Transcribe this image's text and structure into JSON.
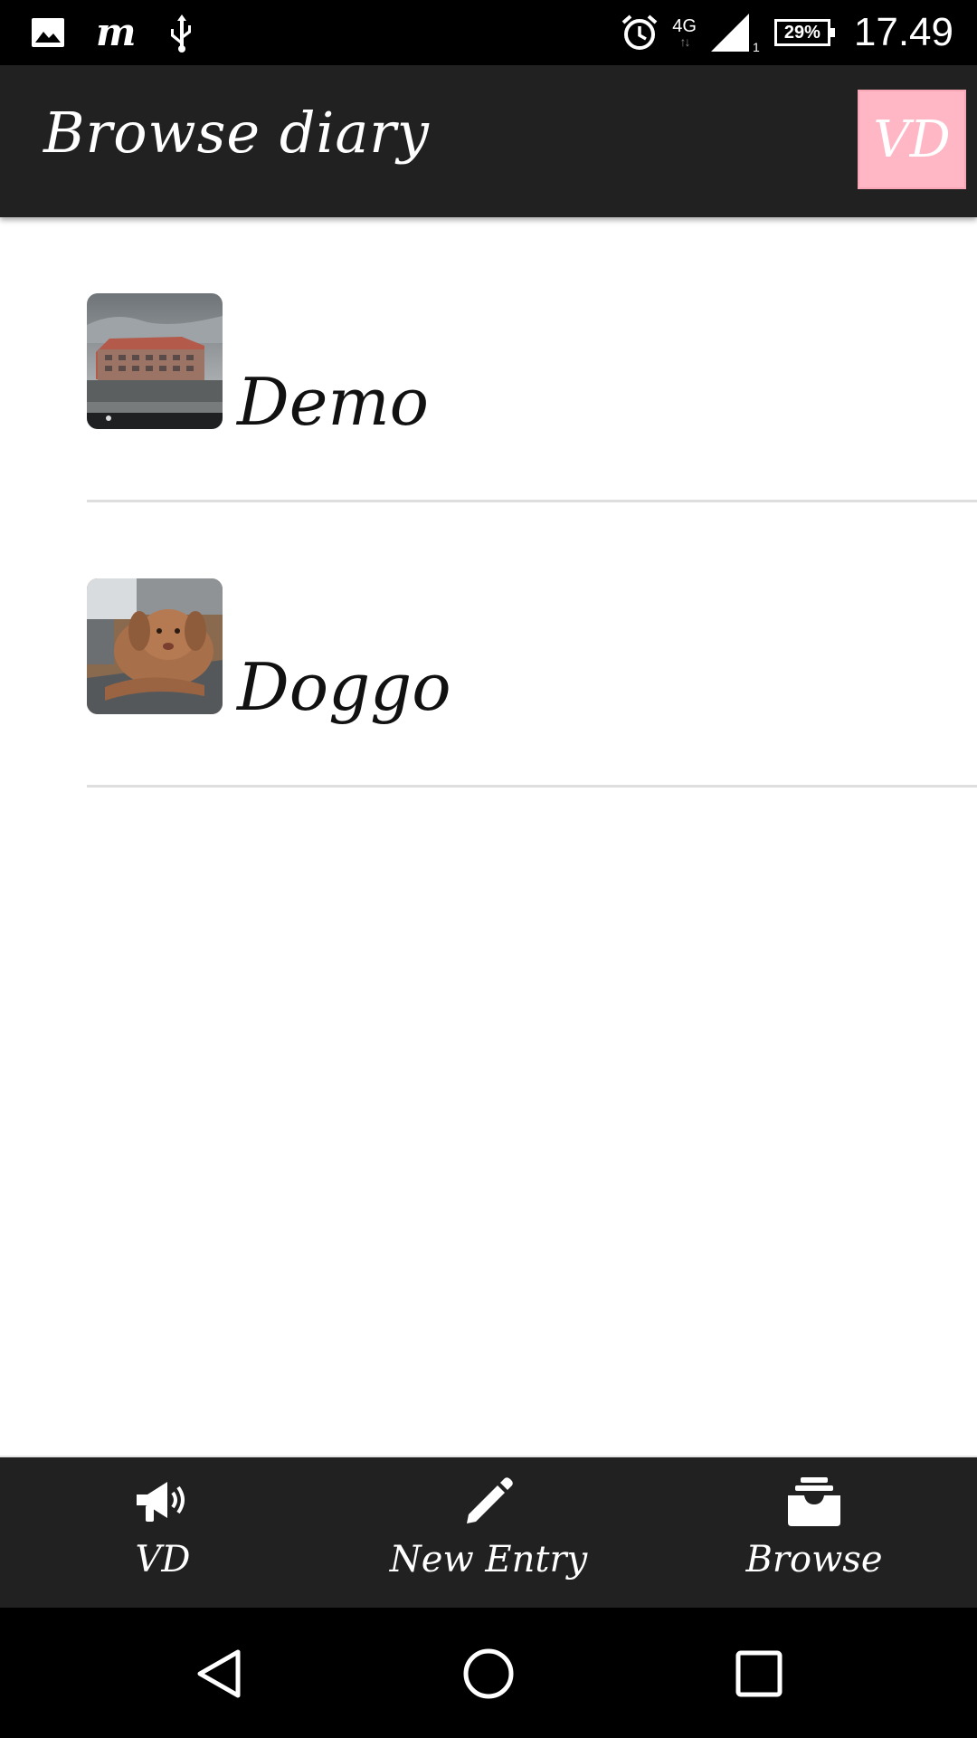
{
  "status_bar": {
    "icons_left": [
      "gallery-icon",
      "m-app-icon",
      "usb-icon"
    ],
    "m_glyph": "m",
    "network": "4G",
    "network_arrows": "↑↓",
    "signal_sim": "1",
    "battery": "29%",
    "time": "17.49"
  },
  "app_bar": {
    "title": "Browse diary",
    "logo_text": "VD",
    "logo_color": "#ffb7c5"
  },
  "entries": [
    {
      "title": "Demo",
      "thumbnail": "building-photo"
    },
    {
      "title": "Doggo",
      "thumbnail": "dog-photo"
    }
  ],
  "bottom_nav": {
    "items": [
      {
        "label": "VD",
        "icon": "megaphone-icon",
        "active": false
      },
      {
        "label": "New Entry",
        "icon": "pencil-icon",
        "active": false
      },
      {
        "label": "Browse",
        "icon": "inbox-tray-icon",
        "active": true
      }
    ]
  },
  "system_nav": [
    "back-icon",
    "home-icon",
    "recents-icon"
  ],
  "colors": {
    "bar_background": "#212121",
    "status_background": "#000000",
    "divider": "#dedede"
  }
}
